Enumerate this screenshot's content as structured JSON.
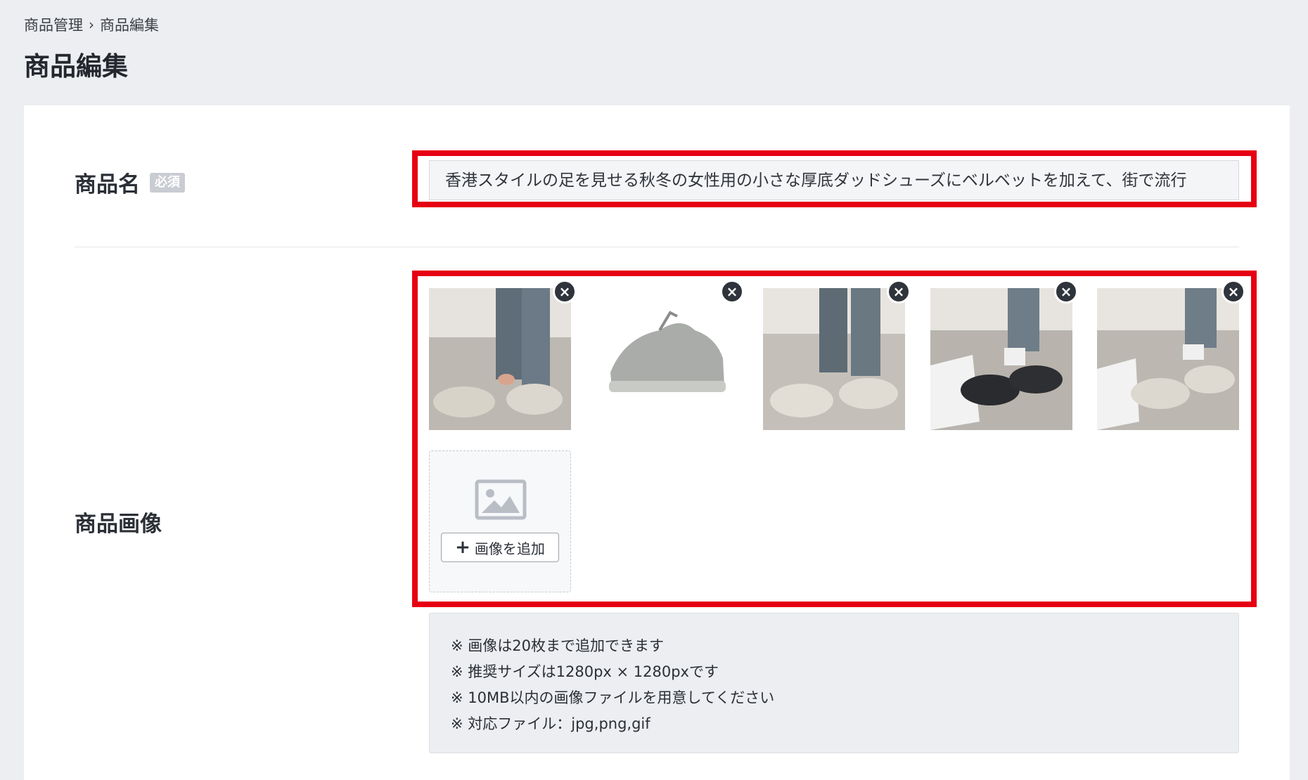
{
  "breadcrumb": {
    "parent": "商品管理",
    "separator": "›",
    "current": "商品編集"
  },
  "page_title": "商品編集",
  "form": {
    "name_label": "商品名",
    "required_badge": "必須",
    "name_value": "香港スタイルの足を見せる秋冬の女性用の小さな厚底ダッドシューズにベルベットを加えて、街で流行",
    "image_label": "商品画像",
    "images": [
      {
        "alt": "product-photo-1",
        "remove_label": "×"
      },
      {
        "alt": "product-photo-2",
        "remove_label": "×"
      },
      {
        "alt": "product-photo-3",
        "remove_label": "×"
      },
      {
        "alt": "product-photo-4",
        "remove_label": "×"
      },
      {
        "alt": "product-photo-5",
        "remove_label": "×"
      }
    ],
    "add_image_plus": "+",
    "add_image_label": "画像を追加",
    "notes": [
      "※ 画像は20枚まで追加できます",
      "※ 推奨サイズは1280px × 1280pxです",
      "※ 10MB以内の画像ファイルを用意してください",
      "※ 対応ファイル：jpg,png,gif"
    ]
  },
  "colors": {
    "highlight": "#e60012",
    "background": "#eceef1",
    "card": "#ffffff",
    "badge": "#c9ccd2"
  }
}
